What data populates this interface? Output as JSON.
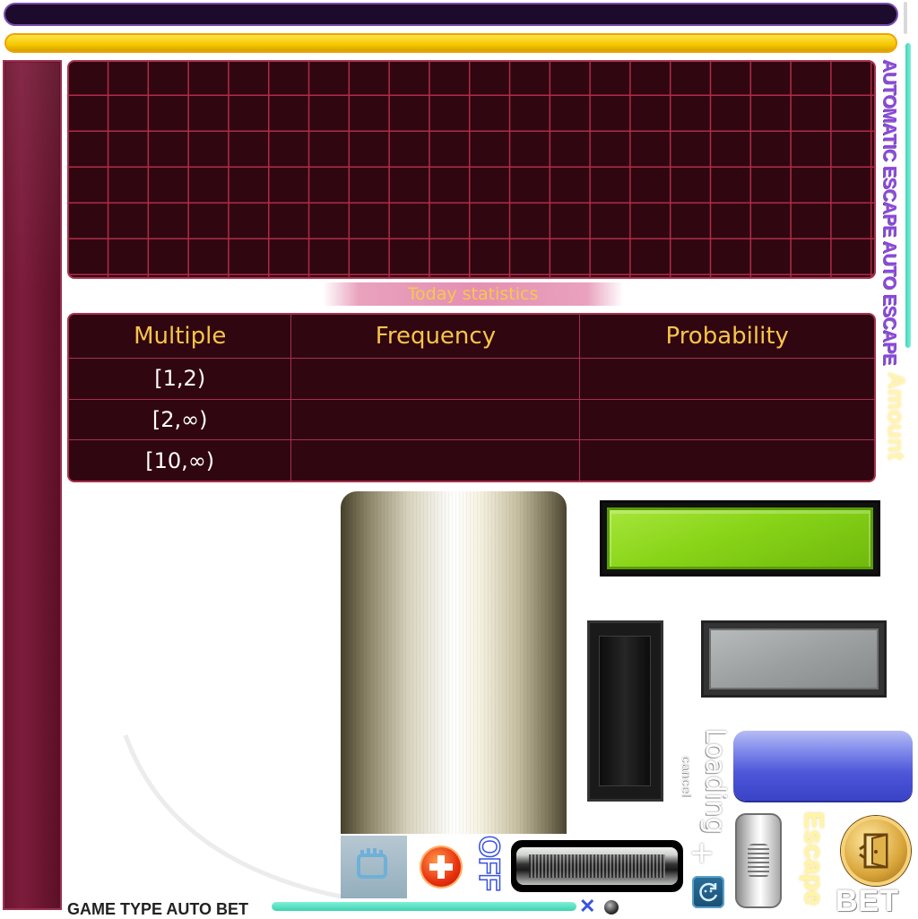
{
  "right_vertical_text": "AUTOMATIC ESCAPE  AUTO ESCAPE",
  "amount_text": "Amount",
  "today_statistics_label": "Today statistics",
  "stats": {
    "headers": [
      "Multiple",
      "Frequency",
      "Probability"
    ],
    "rows": [
      {
        "multiple": "[1,2)",
        "frequency": "",
        "probability": ""
      },
      {
        "multiple": "[2,∞)",
        "frequency": "",
        "probability": ""
      },
      {
        "multiple": "[10,∞)",
        "frequency": "",
        "probability": ""
      }
    ]
  },
  "loading_text": "Loading",
  "cancel_text": "cancel",
  "plus_icon": "+",
  "escape_text": "Escape",
  "bet_text": "BET",
  "off_text": "OFF",
  "footer": {
    "game_type": "GAME TYPE AUTO BET"
  },
  "icons": {
    "fist": "fist-icon",
    "add": "add-icon",
    "refresh": "refresh-icon",
    "close": "close-icon",
    "door": "door-icon"
  },
  "colors": {
    "panel_bg": "#300610",
    "panel_border": "#a8304c",
    "header_text": "#f7c44a",
    "accent_green": "#88d418",
    "accent_blue": "#4d57d8",
    "accent_yellow": "#f5c800",
    "teal": "#3dd2b0"
  }
}
